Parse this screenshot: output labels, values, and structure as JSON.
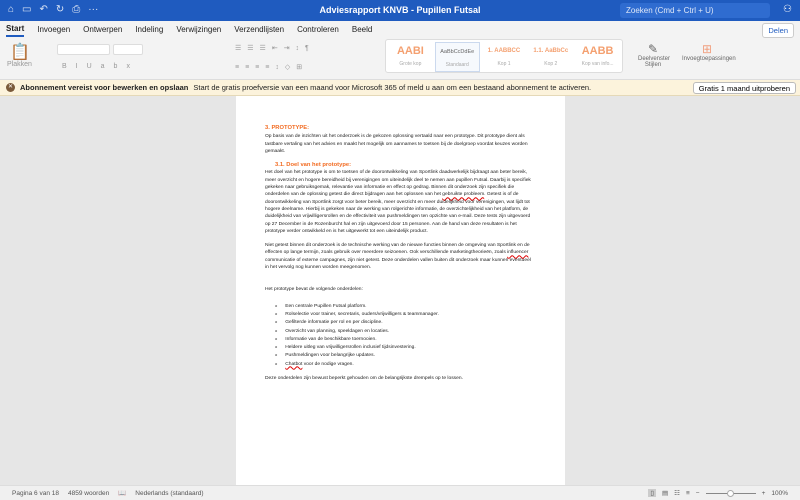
{
  "window": {
    "title": "Adviesrapport KNVB - Pupillen Futsal",
    "search_placeholder": "Zoeken (Cmd + Ctrl + U)"
  },
  "tabs": [
    "Start",
    "Invoegen",
    "Ontwerpen",
    "Indeling",
    "Verwijzingen",
    "Verzendlijsten",
    "Controleren",
    "Beeld"
  ],
  "share_label": "Delen",
  "ribbon": {
    "paste": "Plakken",
    "styles": [
      {
        "preview": "AABI",
        "name": "Grote kop"
      },
      {
        "preview": "AaBbCcDdEe",
        "name": "Standaard"
      },
      {
        "preview": "1. AABBCC",
        "name": "Kop 1"
      },
      {
        "preview": "1.1. AaBbCc",
        "name": "Kop 2"
      },
      {
        "preview": "AABB",
        "name": "Kop van info..."
      }
    ],
    "styles_pane": "Deelvenster Stijlen",
    "addins": "Invoegtoepassingen"
  },
  "notice": {
    "bold": "Abonnement vereist voor bewerken en opslaan",
    "text": "Start de gratis proefversie van een maand voor Microsoft 365 of meld u aan om een bestaand abonnement te activeren.",
    "button": "Gratis 1 maand uitproberen"
  },
  "document": {
    "h1": "3.   PROTOTYPE:",
    "p1": "Op basis van de inzichten uit het onderzoek is de gekozen oplossing vertaald naar een prototype. Dit prototype dient als tastbare vertaling van het advies en maakt het mogelijk om aannames te toetsen bij de doelgroep voordat keuzes worden gemaakt.",
    "h2": "3.1. Doel van het prototype:",
    "p2a": "Het doel van het prototype is om te toetsen of de doorontwikkeling van Sportlink daadwerkelijk bijdraagt aan beter bereik, meer overzicht en hogere bereidheid bij verenigingen om uiteindelijk deel te nemen aan pupillen Futsal. Daarbij is specifiek gekeken naar gebruiksgemak, relevantie van informatie en effect op gedrag. Binnen dit onderzoek zijn specifiek die onderdelen van de oplossing getest die direct bijdragen aan het oplossen van het ",
    "p2sq": "gebruikte probleem",
    "p2b": ". Getest is of de doorontwikkeling van Sportlink zorgt voor beter bereik, meer overzicht en meer duidelijkheid voor verenigingen, wat lijdt tot hogere deelname. Hierbij is gekeken naar de werking van rolgerichte informatie, de overzichtelijkheid van het platform, de duidelijkheid van vrijwilligersrollen en de effectiviteit van pushmeldingen ten opzichte van e-mail. Deze tests zijn uitgevoerd op 27 December in de Rozenburcht hal en zijn uitgevoerd door 15 personen. Aan de hand van deze resultaten is het prototype verder ontwikkeld en is het uitgewerkt tot een uiteindelijk product.",
    "p3a": "Niet getest binnen dit onderzoek is de technische werking van de nieuwe functies binnen de omgeving van Sportlink en de effecten op lange termijn, zoals gebruik over meerdere seizoenen. Ook verschillende marketingtheorieën, zoals ",
    "p3sq": "influencer",
    "p3b": " communicatie of externe campagnes, zijn niet getest. Deze onderdelen vallen buiten dit onderzoek maar kunnen eventueel in het vervolg nog kunnen worden meegenomen.",
    "p4": "Het prototype bevat de volgende onderdelen:",
    "list": [
      "Een centrale Pupillen Futsal platform.",
      "Rolselectie voor trainer, secretaris, ouders/vrijwilligers & teammanager.",
      "Gefilterde informatie per rol en per discipline.",
      "Overzicht van planning, speeldagen en locaties.",
      "Informatie van de beschikbare toernooien.",
      "Heldere uitleg van vrijwilligersrollen inclusief tijdsinvestering.",
      "Pushmeldingen voor belangrijke updates."
    ],
    "last_item_sq": "Chatbot",
    "last_item_rest": " voor de nodige vragen.",
    "p5": "Deze onderdelen zijn bewust beperkt gehouden om de belangrijkste drempels op te lossen."
  },
  "status": {
    "page": "Pagina 6 van 18",
    "words": "4859 woorden",
    "language": "Nederlands (standaard)",
    "zoom": "100%",
    "zoom_fraction": 0.5
  }
}
